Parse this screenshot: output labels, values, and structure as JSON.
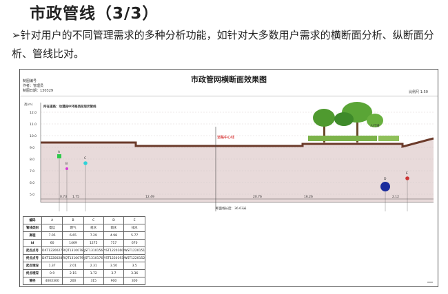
{
  "title": "市政管线（3/3）",
  "description": "➢针对用户的不同管理需求的多种分析功能，如针对大多数用户需求的横断面分析、纵断面分析、管线比对。",
  "drawing": {
    "title": "市政管网横断面效果图",
    "meta": [
      "制图编号",
      "作者：管理员",
      "制图日期：130329"
    ],
    "scale": "比例尺 1:50",
    "y_unit": "高(m)",
    "y_ticks": [
      "12.0",
      "11.0",
      "10.0",
      "9.0",
      "8.0",
      "7.0",
      "6.0",
      "5.0"
    ],
    "road_label": "所在道路：动漫园中环路西段现状管线",
    "center_label": "道路中心线",
    "tree_label": "人行道",
    "dims": [
      "0.73",
      "1.75",
      "12.49",
      "20.76",
      "16.26",
      "2.12"
    ],
    "total_width": "断面线长度：36.63米",
    "pipes": [
      {
        "id": "A",
        "color": "#2ec94a"
      },
      {
        "id": "B",
        "color": "#d63ad6"
      },
      {
        "id": "C",
        "color": "#2fd3d8"
      },
      {
        "id": "D",
        "color": "#1a2c9c"
      },
      {
        "id": "E",
        "color": "#c33"
      }
    ],
    "table": {
      "header": [
        "编码",
        "A",
        "B",
        "C",
        "D",
        "E"
      ],
      "rows": [
        [
          "管线类别",
          "电信",
          "燃气",
          "给水",
          "雨水",
          "排水"
        ],
        [
          "高程",
          "7.05",
          "6.65",
          "7.29",
          "4.98",
          "5.77"
        ],
        [
          "id",
          "60",
          "1469",
          "1275",
          "717",
          "670"
        ],
        [
          "起点点号",
          "DXT1220027",
          "RQT1310078",
          "JST1310156",
          "YST1220160",
          "WST1220151"
        ],
        [
          "终点点号",
          "DXT1220028",
          "RQT1310079",
          "JST1310176",
          "YST1220193",
          "WST1220152"
        ],
        [
          "起点埋深",
          "1.37",
          "2.01",
          "2.31",
          "3.50",
          "3.5"
        ],
        [
          "终点埋深",
          "0.9",
          "2.15",
          "1.72",
          "3.7",
          "3.36"
        ],
        [
          "管径",
          "400X300",
          "200",
          "315",
          "900",
          "300"
        ]
      ]
    }
  }
}
